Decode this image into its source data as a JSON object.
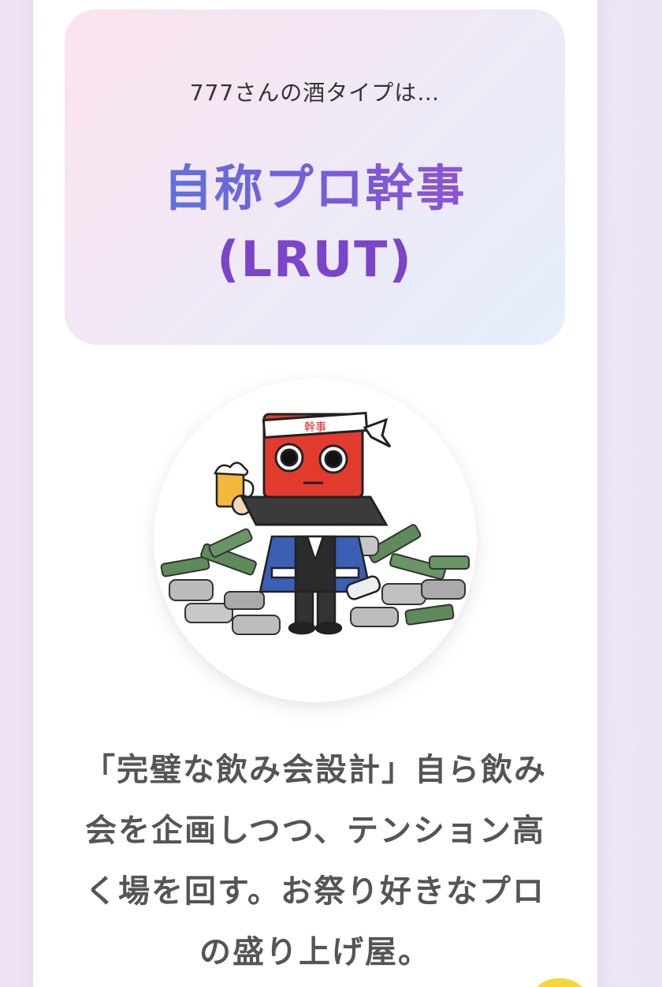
{
  "result": {
    "intro_text": "777さんの酒タイプは…",
    "type_name": "自称プロ幹事",
    "type_code": "(LRUT)"
  },
  "character": {
    "headband_text": "幹事",
    "icon": "party-organizer-laptop-character"
  },
  "description": "「完璧な飲み会設計」自ら飲み会を企画しつつ、テンション高く場を回す。お祭り好きなプロの盛り上げ屋。",
  "colors": {
    "title_gradient_start": "#4f7fe0",
    "title_gradient_end": "#9a4fd0",
    "code_color": "#7b45c9",
    "badge": "#f5d63a"
  }
}
